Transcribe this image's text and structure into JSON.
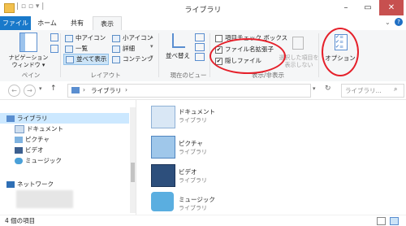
{
  "window": {
    "title": "ライブラリ"
  },
  "tabs": {
    "file": "ファイル",
    "home": "ホーム",
    "share": "共有",
    "view": "表示"
  },
  "ribbon": {
    "nav_pane": "ナビゲーション",
    "nav_pane_sub": "ウィンドウ ▾",
    "pane_group": "ペイン",
    "layout": {
      "medium_icons": "中アイコン",
      "small_icons": "小アイコン",
      "list": "一覧",
      "details": "詳細",
      "tiles": "並べて表示",
      "content": "コンテンツ",
      "group_label": "レイアウト"
    },
    "sort_by": "並べ替え",
    "current_view_label": "現在のビュー",
    "item_checkboxes": "項目チェック ボックス",
    "file_extensions": "ファイル名拡張子",
    "hidden_items": "隠しファイル",
    "hide_selected_line1": "選択した項目を",
    "hide_selected_line2": "表示しない",
    "show_hide_label": "表示/非表示",
    "options": "オプション"
  },
  "address": {
    "path": "ライブラリ",
    "search_placeholder": "ライブラリ..."
  },
  "nav": {
    "libraries": "ライブラリ",
    "documents": "ドキュメント",
    "pictures": "ピクチャ",
    "videos": "ビデオ",
    "music": "ミュージック",
    "network": "ネットワーク"
  },
  "items": [
    {
      "name": "ドキュメント",
      "type": "ライブラリ"
    },
    {
      "name": "ピクチャ",
      "type": "ライブラリ"
    },
    {
      "name": "ビデオ",
      "type": "ライブラリ"
    },
    {
      "name": "ミュージック",
      "type": "ライブラリ"
    }
  ],
  "status": {
    "count": "4 個の項目"
  }
}
